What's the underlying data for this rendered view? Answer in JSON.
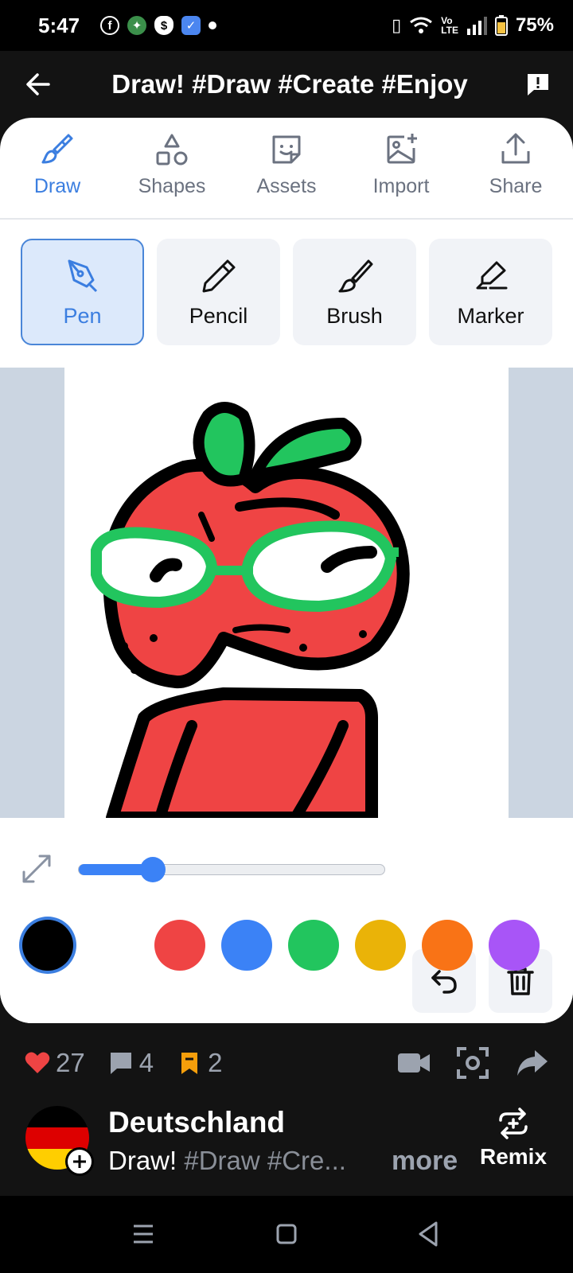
{
  "status_bar": {
    "time": "5:47",
    "battery": "75%"
  },
  "header": {
    "title": "Draw! #Draw #Create #Enjoy"
  },
  "tabs": [
    {
      "label": "Draw",
      "icon": "paintbrush-icon",
      "active": true
    },
    {
      "label": "Shapes",
      "icon": "shapes-icon",
      "active": false
    },
    {
      "label": "Assets",
      "icon": "sticker-icon",
      "active": false
    },
    {
      "label": "Import",
      "icon": "image-plus-icon",
      "active": false
    },
    {
      "label": "Share",
      "icon": "share-icon",
      "active": false
    }
  ],
  "brushes": [
    {
      "label": "Pen",
      "icon": "pen-nib-icon",
      "active": true
    },
    {
      "label": "Pencil",
      "icon": "pencil-icon",
      "active": false
    },
    {
      "label": "Brush",
      "icon": "brush-icon",
      "active": false
    },
    {
      "label": "Marker",
      "icon": "highlighter-icon",
      "active": false
    }
  ],
  "brush_size": {
    "fraction": 0.24
  },
  "colors": {
    "accent": "#3b7ee0",
    "palette": [
      "#000000",
      "#ef4444",
      "#3b82f6",
      "#22c55e",
      "#eab308",
      "#f97316",
      "#a855f7"
    ],
    "selected": "#000000"
  },
  "social": {
    "likes": "27",
    "comments": "4",
    "bookmarks": "2"
  },
  "author": {
    "name": "Deutschland",
    "desc_prefix": "Draw! ",
    "desc_tags": "#Draw #Cre...",
    "more": "more",
    "remix": "Remix"
  }
}
